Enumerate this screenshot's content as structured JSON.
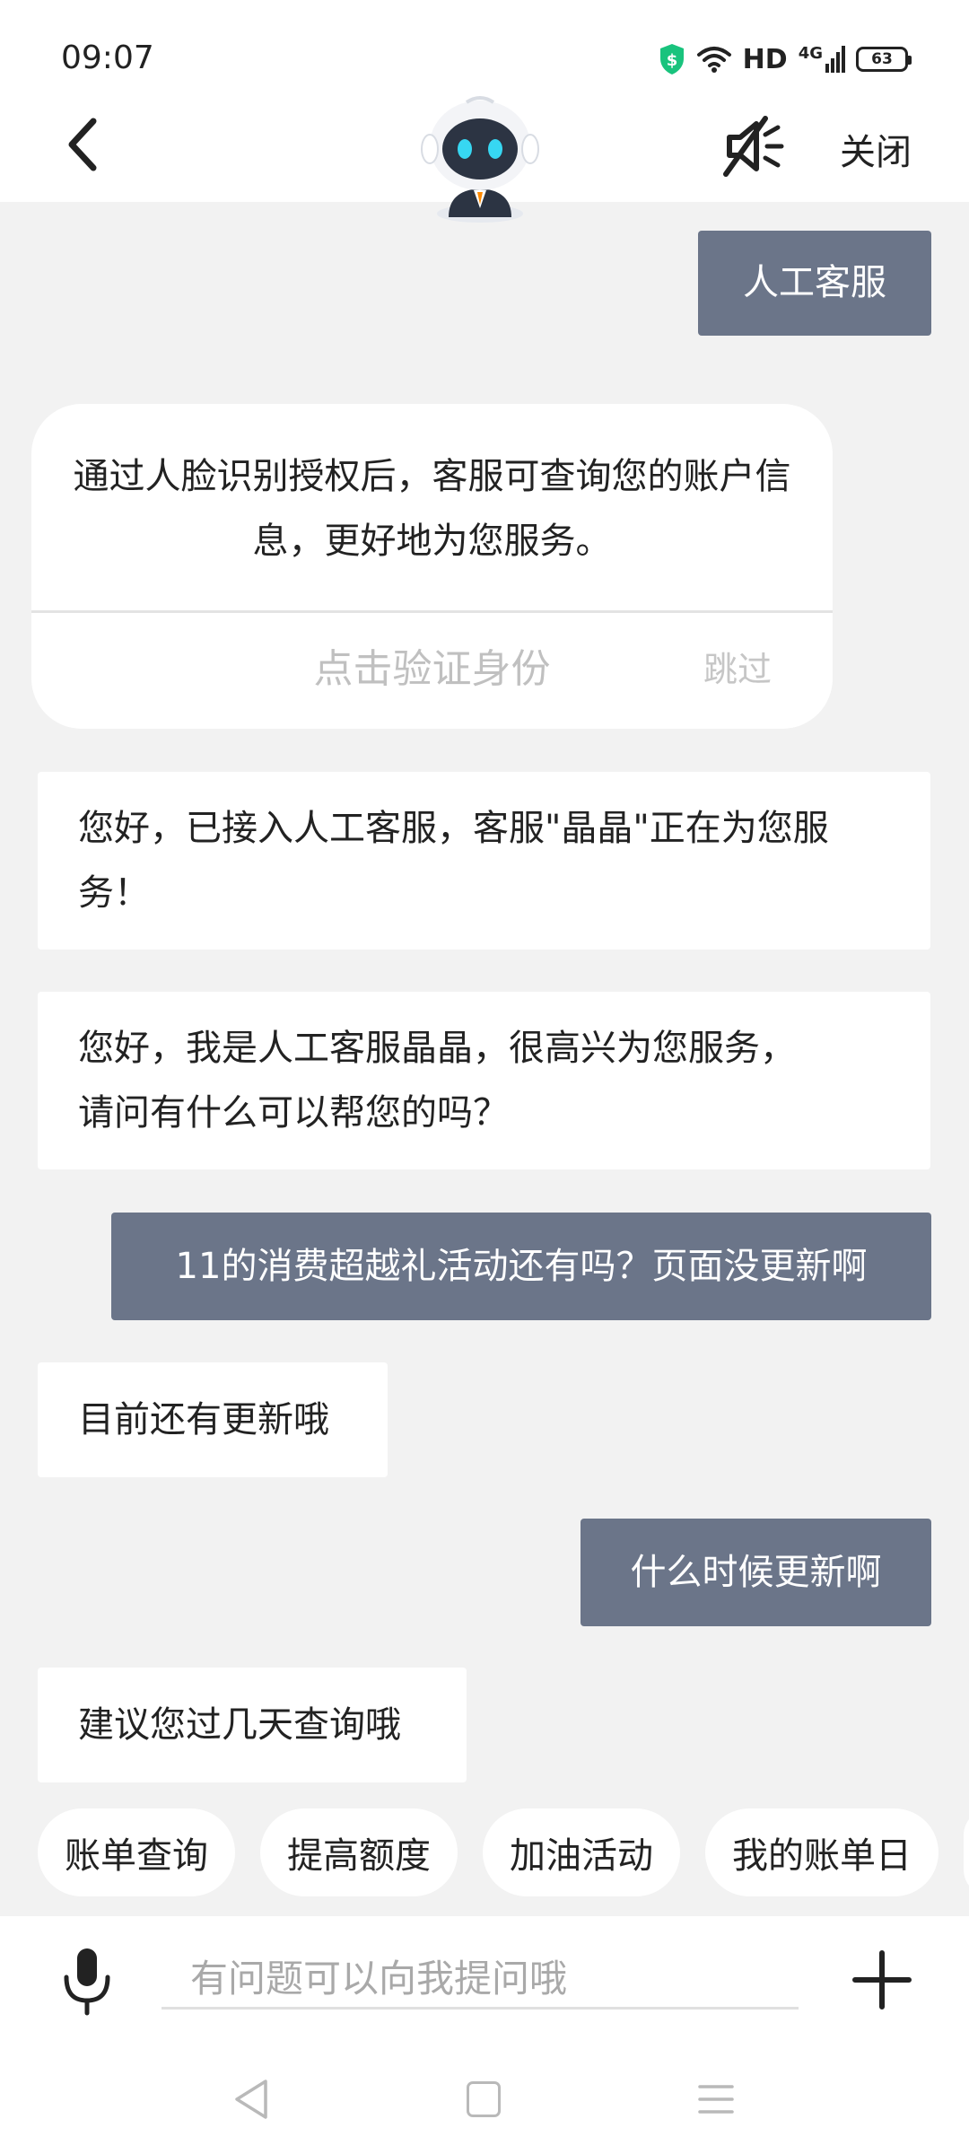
{
  "status_bar": {
    "time": "09:07",
    "network_label": "HD",
    "network_type": "4G",
    "battery": "63"
  },
  "header": {
    "close_label": "关闭",
    "back_icon": "chevron-left-icon",
    "mute_icon": "speaker-muted-icon",
    "avatar_icon": "robot-avatar-icon"
  },
  "colors": {
    "user_bubble": "#6b7589",
    "background": "#f2f2f2",
    "shield_green": "#19c37d"
  },
  "chat": {
    "msg1": "人工客服",
    "verify_line1": "通过人脸识别授权后，客服可查询您的账户信",
    "verify_line2": "息，更好地为您服务。",
    "verify_action": "点击验证身份",
    "skip_action": "跳过",
    "msg3_line1": "您好，已接入人工客服，客服\"晶晶\"正在为您服",
    "msg3_line2": "务！",
    "msg4_line1": "您好，我是人工客服晶晶，很高兴为您服务，",
    "msg4_line2": "请问有什么可以帮您的吗？",
    "msg5": "11的消费超越礼活动还有吗？页面没更新啊",
    "msg6": "目前还有更新哦",
    "msg7": "什么时候更新啊",
    "msg8": "建议您过几天查询哦"
  },
  "chips": [
    "账单查询",
    "提高额度",
    "加油活动",
    "我的账单日"
  ],
  "input": {
    "placeholder": "有问题可以向我提问哦"
  }
}
